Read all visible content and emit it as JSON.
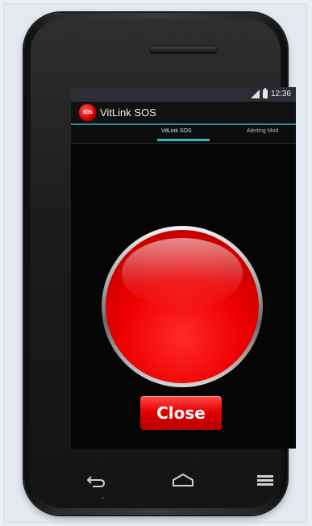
{
  "status_bar": {
    "time": "12:36",
    "icons": [
      "signal-icon",
      "battery-icon"
    ]
  },
  "app": {
    "icon_text": "SOS",
    "title": "VitLink SOS"
  },
  "tabs": {
    "active": "VitLink SOS",
    "items": [
      "VitLink SOS",
      "Alerting Mod"
    ]
  },
  "main": {
    "sos_button": "red-sos-button",
    "close_label": "Close"
  },
  "nav": {
    "icons": [
      "back-icon",
      "home-icon",
      "menu-icon"
    ]
  },
  "colors": {
    "accent": "#36b6c8",
    "sos_red": "#ee0000",
    "screen_bg": "#050505"
  }
}
